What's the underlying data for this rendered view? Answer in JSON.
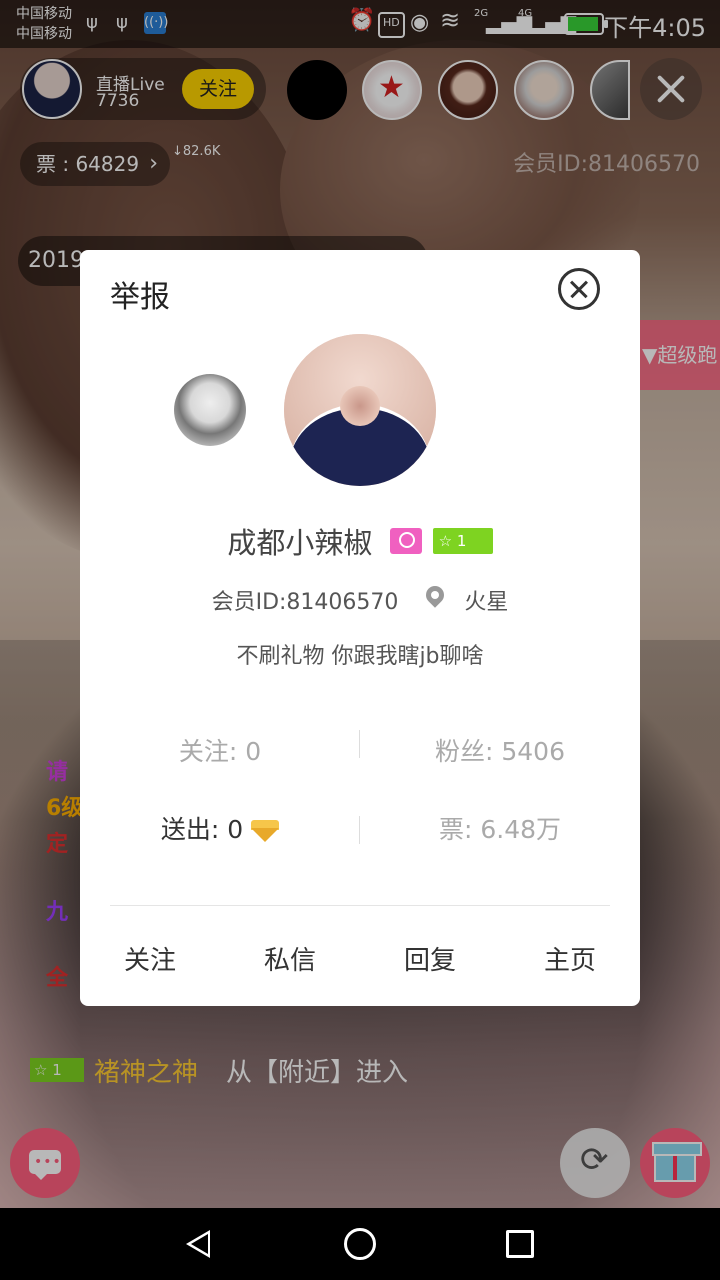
{
  "status_bar": {
    "carrier_1": "中国移动",
    "carrier_2": "中国移动",
    "hd": "HD",
    "net_1": "2G",
    "net_2": "4G",
    "time": "下午4:05"
  },
  "host": {
    "name": "直播Live",
    "count": "7736",
    "follow_label": "关注"
  },
  "tickets": {
    "label": "票 : 64829",
    "chevron": "›",
    "speed": "↓82.6K"
  },
  "member_id_top": "会员ID:81406570",
  "year_banner": "2019",
  "side_banner": "超级跑",
  "chat_lines": [
    "请",
    "6级",
    "定",
    "九",
    "全"
  ],
  "enter_line": {
    "level": "1",
    "name": "褚神之神",
    "text": "从【附近】进入"
  },
  "profile_card": {
    "title": "举报",
    "name": "成都小辣椒",
    "level": "1",
    "member_id": "会员ID:81406570",
    "location": "火星",
    "bio": "不刷礼物 你跟我瞎jb聊啥",
    "stats": {
      "following_label": "关注: ",
      "following_value": "0",
      "fans_label": "粉丝: ",
      "fans_value": "5406",
      "sent_label": "送出: ",
      "sent_value": "0",
      "tickets_label": "票: ",
      "tickets_value": "6.48万"
    },
    "actions": {
      "follow": "关注",
      "message": "私信",
      "reply": "回复",
      "homepage": "主页"
    }
  },
  "colors": {
    "follow_yellow": "#ffd400",
    "accent_pink": "#ff5f7e",
    "level_green": "#7ed321",
    "gender_pink": "#f060c0"
  },
  "icons": [
    "usb-icon",
    "signal-icon",
    "alarm-icon",
    "eye-icon",
    "wifi-icon",
    "battery-icon",
    "close-icon",
    "location-pin-icon",
    "diamond-icon",
    "chat-bubble-icon",
    "share-icon",
    "gift-icon",
    "back-icon",
    "home-icon",
    "recents-icon"
  ]
}
